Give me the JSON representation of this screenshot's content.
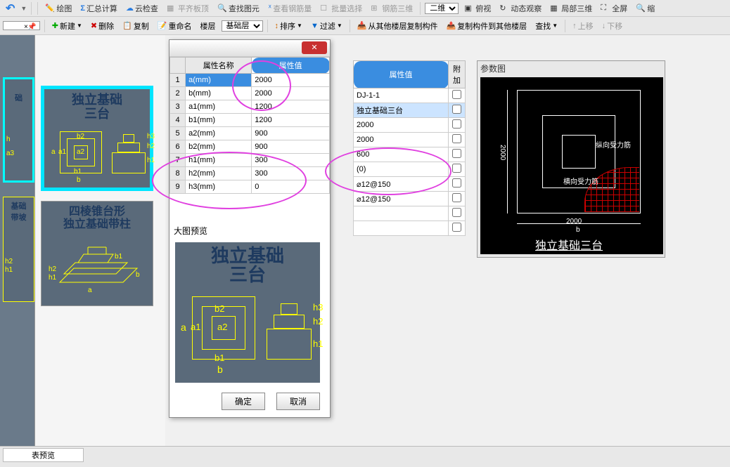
{
  "toolbar1": {
    "undo": "↶",
    "draw": "绘图",
    "sum_calc": "汇总计算",
    "cloud_check": "云检查",
    "align_top": "平齐板顶",
    "find_elem": "查找图元",
    "check_rebar": "查看钢筋量",
    "batch_select": "批量选择",
    "rebar_3d": "钢筋三维",
    "view_2d": "二维",
    "look_down": "俯视",
    "dynamic_view": "动态观察",
    "local_3d": "局部三维",
    "full_screen": "全屏",
    "zoom": "缩"
  },
  "toolbar2": {
    "new": "新建",
    "delete": "删除",
    "copy": "复制",
    "rename": "重命名",
    "floor": "楼层",
    "base_layer": "基础层",
    "sort": "排序",
    "filter": "过滤",
    "copy_from_floor": "从其他楼层复制构件",
    "copy_to_floor": "复制构件到其他楼层",
    "find": "查找",
    "move_up": "上移",
    "move_down": "下移"
  },
  "thumbs": [
    {
      "title1": "独立基础",
      "title2": "三台"
    },
    {
      "title1": "四棱锥台形",
      "title2": "独立基础带柱"
    }
  ],
  "left_partials": [
    {
      "label": "础"
    },
    {
      "label": "基础\n带坡"
    }
  ],
  "dialog": {
    "headers": {
      "name": "属性名称",
      "value": "属性值"
    },
    "rows": [
      {
        "idx": "1",
        "name": "a(mm)",
        "val": "2000"
      },
      {
        "idx": "2",
        "name": "b(mm)",
        "val": "2000"
      },
      {
        "idx": "3",
        "name": "a1(mm)",
        "val": "1200"
      },
      {
        "idx": "4",
        "name": "b1(mm)",
        "val": "1200"
      },
      {
        "idx": "5",
        "name": "a2(mm)",
        "val": "900"
      },
      {
        "idx": "6",
        "name": "b2(mm)",
        "val": "900"
      },
      {
        "idx": "7",
        "name": "h1(mm)",
        "val": "300"
      },
      {
        "idx": "8",
        "name": "h2(mm)",
        "val": "300"
      },
      {
        "idx": "9",
        "name": "h3(mm)",
        "val": "0"
      }
    ],
    "preview_label": "大图预览",
    "preview_title1": "独立基础",
    "preview_title2": "三台",
    "ok": "确定",
    "cancel": "取消"
  },
  "mid": {
    "headers": {
      "value": "属性值",
      "attach": "附加"
    },
    "rows": [
      {
        "val": "DJ-1-1",
        "hl": false
      },
      {
        "val": "独立基础三台",
        "hl": true
      },
      {
        "val": "2000",
        "hl": false
      },
      {
        "val": "2000",
        "hl": false
      },
      {
        "val": "600",
        "hl": false
      },
      {
        "val": "(0)",
        "hl": false
      },
      {
        "val": "⌀12@150",
        "hl": false
      },
      {
        "val": "⌀12@150",
        "hl": false
      },
      {
        "val": "",
        "hl": false
      },
      {
        "val": "",
        "hl": false
      }
    ]
  },
  "right": {
    "title": "参数图",
    "dim_2000v": "2000",
    "dim_2000h": "2000",
    "dim_b": "b",
    "label_v_rebar": "纵向受力筋",
    "label_h_rebar": "横向受力筋",
    "caption": "独立基础三台"
  },
  "bottom": {
    "tab": "表预览"
  },
  "dim_labels": {
    "a": "a",
    "a1": "a1",
    "a2": "a2",
    "b": "b",
    "b1": "b1",
    "b2": "b2",
    "h": "h",
    "h1": "h1",
    "h2": "h2",
    "h3": "h3",
    "a3": "a3"
  }
}
